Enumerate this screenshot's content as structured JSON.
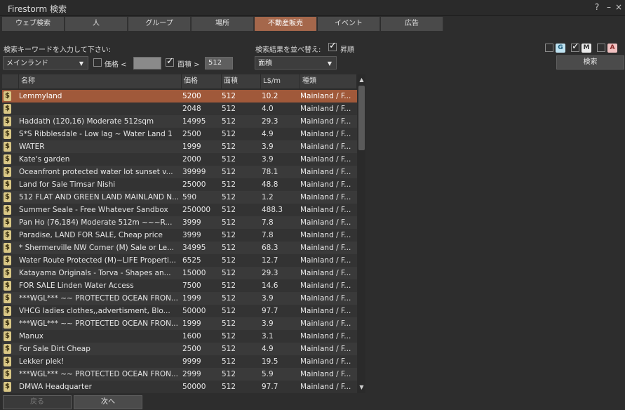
{
  "window": {
    "title": "Firestorm 検索",
    "help": "?",
    "minimize": "–",
    "close": "×"
  },
  "tabs": [
    {
      "label": "ウェブ検索"
    },
    {
      "label": "人"
    },
    {
      "label": "グループ"
    },
    {
      "label": "場所"
    },
    {
      "label": "不動産販売",
      "active": true
    },
    {
      "label": "イベント"
    },
    {
      "label": "広告"
    }
  ],
  "search": {
    "keyword_label": "検索キーワードを入力して下さい:",
    "category_value": "メインランド",
    "price_label": "価格 <",
    "price_checked": false,
    "area_label": "面積  >",
    "area_checked": true,
    "area_value": "512",
    "sort_label": "検索結果を並べ替え:",
    "ascending_label": "昇順",
    "ascending_checked": true,
    "sort_value": "面積",
    "search_button": "検索"
  },
  "maturity": {
    "g": "G",
    "m": "M",
    "a": "A",
    "g_checked": false,
    "m_checked": true,
    "a_checked": false
  },
  "table": {
    "headers": {
      "name": "名称",
      "price": "価格",
      "area": "面積",
      "ppm": "L$/m",
      "type": "種類"
    },
    "rows": [
      {
        "name": "Lemmyland",
        "price": "5200",
        "area": "512",
        "ppm": "10.2",
        "type": "Mainland / F..."
      },
      {
        "name": "",
        "price": "2048",
        "area": "512",
        "ppm": "4.0",
        "type": "Mainland / F..."
      },
      {
        "name": "Haddath (120,16) Moderate 512sqm",
        "price": "14995",
        "area": "512",
        "ppm": "29.3",
        "type": "Mainland / F..."
      },
      {
        "name": "S*S Ribblesdale - Low lag ~ Water Land 1",
        "price": "2500",
        "area": "512",
        "ppm": "4.9",
        "type": "Mainland / F..."
      },
      {
        "name": "WATER",
        "price": "1999",
        "area": "512",
        "ppm": "3.9",
        "type": "Mainland / F..."
      },
      {
        "name": "Kate's garden",
        "price": "2000",
        "area": "512",
        "ppm": "3.9",
        "type": "Mainland / F..."
      },
      {
        "name": "Oceanfront protected water lot sunset v...",
        "price": "39999",
        "area": "512",
        "ppm": "78.1",
        "type": "Mainland / F..."
      },
      {
        "name": "Land for Sale Timsar Nishi",
        "price": "25000",
        "area": "512",
        "ppm": "48.8",
        "type": "Mainland / F..."
      },
      {
        "name": "512 FLAT AND GREEN LAND MAINLAND N...",
        "price": "590",
        "area": "512",
        "ppm": "1.2",
        "type": "Mainland / F..."
      },
      {
        "name": "Summer Seale - Free Whatever Sandbox",
        "price": "250000",
        "area": "512",
        "ppm": "488.3",
        "type": "Mainland / F..."
      },
      {
        "name": "Pan Ho (76,184) Moderate 512m ~~~R...",
        "price": "3999",
        "area": "512",
        "ppm": "7.8",
        "type": "Mainland / F..."
      },
      {
        "name": "Paradise, LAND FOR SALE, Cheap price",
        "price": "3999",
        "area": "512",
        "ppm": "7.8",
        "type": "Mainland / F..."
      },
      {
        "name": "* Shermerville NW Corner (M) Sale or Le...",
        "price": "34995",
        "area": "512",
        "ppm": "68.3",
        "type": "Mainland / F..."
      },
      {
        "name": "Water Route Protected (M)~LIFE Properti...",
        "price": "6525",
        "area": "512",
        "ppm": "12.7",
        "type": "Mainland / F..."
      },
      {
        "name": "Katayama Originals - Torva - Shapes an...",
        "price": "15000",
        "area": "512",
        "ppm": "29.3",
        "type": "Mainland / F..."
      },
      {
        "name": "FOR SALE  Linden Water Access",
        "price": "7500",
        "area": "512",
        "ppm": "14.6",
        "type": "Mainland / F..."
      },
      {
        "name": "***WGL*** ~~ PROTECTED OCEAN FRON...",
        "price": "1999",
        "area": "512",
        "ppm": "3.9",
        "type": "Mainland / F..."
      },
      {
        "name": "VHCG ladies clothes,,advertisment,  Blo...",
        "price": "50000",
        "area": "512",
        "ppm": "97.7",
        "type": "Mainland / F..."
      },
      {
        "name": "***WGL*** ~~ PROTECTED OCEAN FRON...",
        "price": "1999",
        "area": "512",
        "ppm": "3.9",
        "type": "Mainland / F..."
      },
      {
        "name": "Manux",
        "price": "1600",
        "area": "512",
        "ppm": "3.1",
        "type": "Mainland / F..."
      },
      {
        "name": "For Sale Dirt  Cheap",
        "price": "2500",
        "area": "512",
        "ppm": "4.9",
        "type": "Mainland / F..."
      },
      {
        "name": "Lekker plek!",
        "price": "9999",
        "area": "512",
        "ppm": "19.5",
        "type": "Mainland / F..."
      },
      {
        "name": "***WGL*** ~~ PROTECTED OCEAN FRON...",
        "price": "2999",
        "area": "512",
        "ppm": "5.9",
        "type": "Mainland / F..."
      },
      {
        "name": "DMWA Headquarter",
        "price": "50000",
        "area": "512",
        "ppm": "97.7",
        "type": "Mainland / F..."
      }
    ]
  },
  "pager": {
    "prev": "戻る",
    "next": "次へ"
  },
  "colors": {
    "selected_row": "#a0593a",
    "active_tab": "#a5674b"
  },
  "icons": {
    "row_icon": "dollar-sign-icon"
  }
}
